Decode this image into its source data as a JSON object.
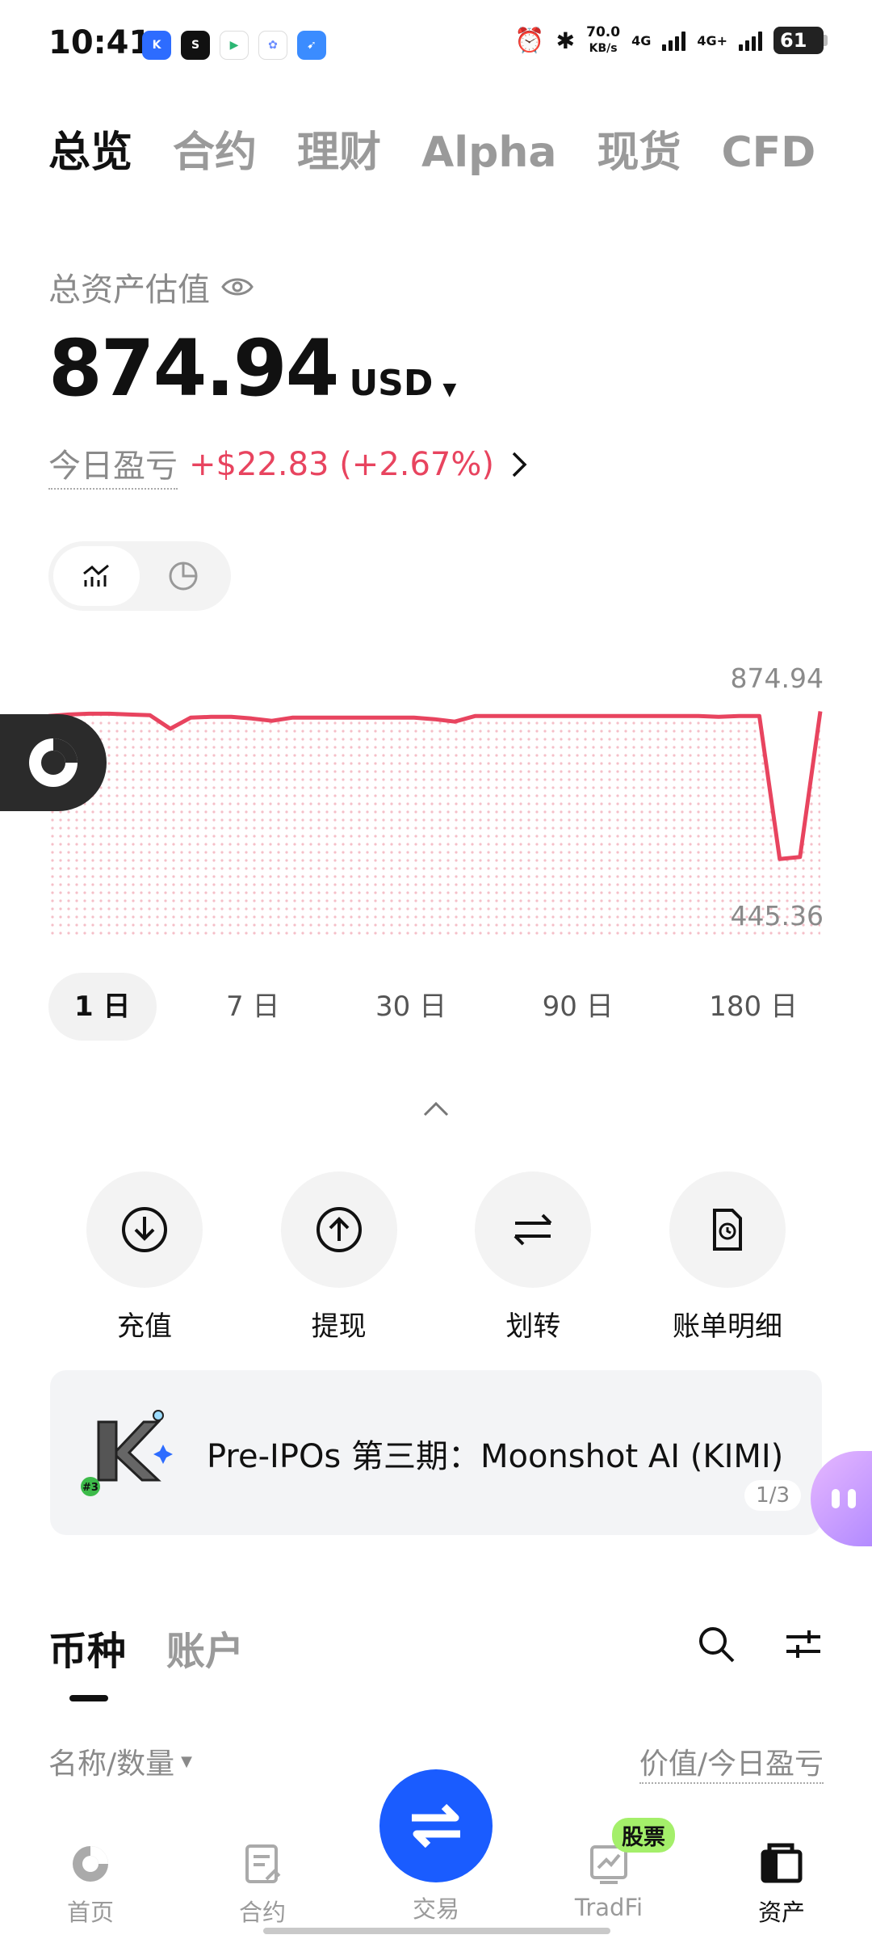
{
  "status_bar": {
    "time": "10:41",
    "speed_value": "70.0",
    "speed_unit": "KB/s",
    "net1": "4G",
    "net2": "4G+",
    "battery": "61",
    "app_icons": [
      "k-app-icon",
      "soul-app-icon",
      "play-app-icon",
      "cloud-app-icon",
      "browser-app-icon"
    ]
  },
  "top_tabs": [
    "总览",
    "合约",
    "理财",
    "Alpha",
    "现货",
    "CFD"
  ],
  "balance": {
    "label": "总资产估值",
    "value": "874.94",
    "currency": "USD",
    "pnl_label": "今日盈亏",
    "pnl_value": "+$22.83 (+2.67%)"
  },
  "chart_data": {
    "type": "area",
    "max_label": "874.94",
    "min_label": "445.36",
    "ylim": [
      445.36,
      874.94
    ],
    "y": [
      862,
      866,
      868,
      868,
      866,
      864,
      830,
      858,
      860,
      860,
      856,
      850,
      858,
      858,
      858,
      858,
      858,
      858,
      858,
      854,
      848,
      862,
      862,
      862,
      862,
      862,
      862,
      862,
      862,
      862,
      862,
      862,
      862,
      860,
      862,
      862,
      500,
      505,
      874
    ]
  },
  "ranges": [
    "1 日",
    "7 日",
    "30 日",
    "90 日",
    "180 日"
  ],
  "actions": [
    {
      "label": "充值",
      "icon": "deposit-icon"
    },
    {
      "label": "提现",
      "icon": "withdraw-icon"
    },
    {
      "label": "划转",
      "icon": "transfer-icon"
    },
    {
      "label": "账单明细",
      "icon": "bill-icon"
    }
  ],
  "banner": {
    "text": "Pre-IPOs 第三期：Moonshot AI (KIMI)",
    "page": "1/3",
    "logo_tag": "#3"
  },
  "section_tabs": [
    "币种",
    "账户"
  ],
  "list_head": {
    "left": "名称/数量",
    "right": "价值/今日盈亏"
  },
  "bottom_nav": {
    "home": "首页",
    "futures": "合约",
    "trade": "交易",
    "tradfi": "TradFi",
    "assets": "资产",
    "badge": "股票"
  },
  "colors": {
    "accent_blue": "#1a5cff",
    "pnl_red": "#e8445f",
    "badge_green": "#a4ef6a"
  }
}
